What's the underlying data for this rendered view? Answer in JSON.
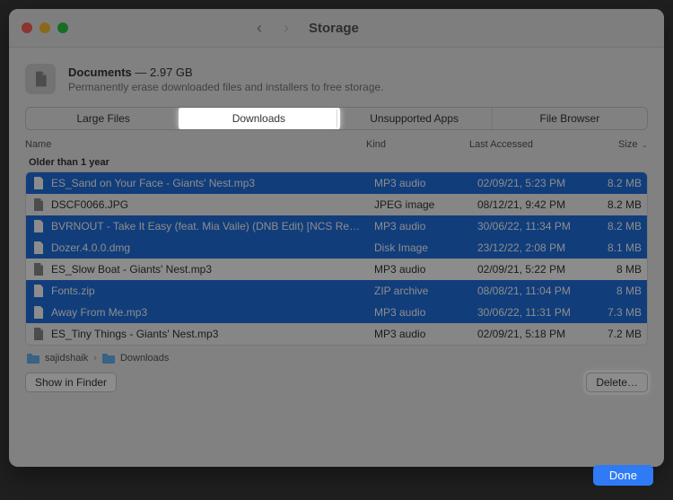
{
  "titlebar": {
    "title": "Storage",
    "traffic": {
      "close": "#ff5f57",
      "min": "#febc2e",
      "max": "#28c840"
    }
  },
  "header": {
    "title_strong": "Documents",
    "title_size": " — 2.97 GB",
    "subtitle": "Permanently erase downloaded files and installers to free storage."
  },
  "tabs": [
    {
      "label": "Large Files",
      "active": false
    },
    {
      "label": "Downloads",
      "active": true
    },
    {
      "label": "Unsupported Apps",
      "active": false
    },
    {
      "label": "File Browser",
      "active": false
    }
  ],
  "columns": {
    "name": "Name",
    "kind": "Kind",
    "last": "Last Accessed",
    "size": "Size"
  },
  "section": "Older than 1 year",
  "rows": [
    {
      "name": "ES_Sand on Your Face - Giants' Nest.mp3",
      "kind": "MP3 audio",
      "date": "02/09/21, 5:23 PM",
      "size": "8.2 MB",
      "sel": true,
      "icon": "audio"
    },
    {
      "name": "DSCF0066.JPG",
      "kind": "JPEG image",
      "date": "08/12/21, 9:42 PM",
      "size": "8.2 MB",
      "sel": false,
      "icon": "image"
    },
    {
      "name": "BVRNOUT - Take It Easy (feat. Mia Vaile) (DNB Edit) [NCS Re…",
      "kind": "MP3 audio",
      "date": "30/06/22, 11:34 PM",
      "size": "8.2 MB",
      "sel": true,
      "icon": "audio"
    },
    {
      "name": "Dozer.4.0.0.dmg",
      "kind": "Disk Image",
      "date": "23/12/22, 2:08 PM",
      "size": "8.1 MB",
      "sel": true,
      "icon": "dmg"
    },
    {
      "name": "ES_Slow Boat - Giants' Nest.mp3",
      "kind": "MP3 audio",
      "date": "02/09/21, 5:22 PM",
      "size": "8 MB",
      "sel": false,
      "icon": "audio"
    },
    {
      "name": "Fonts.zip",
      "kind": "ZIP archive",
      "date": "08/08/21, 11:04 PM",
      "size": "8 MB",
      "sel": true,
      "icon": "zip"
    },
    {
      "name": "Away From Me.mp3",
      "kind": "MP3 audio",
      "date": "30/06/22, 11:31 PM",
      "size": "7.3 MB",
      "sel": true,
      "icon": "audio"
    },
    {
      "name": "ES_Tiny Things - Giants' Nest.mp3",
      "kind": "MP3 audio",
      "date": "02/09/21, 5:18 PM",
      "size": "7.2 MB",
      "sel": false,
      "icon": "audio"
    }
  ],
  "breadcrumbs": {
    "a": "sajidshaik",
    "b": "Downloads"
  },
  "footer": {
    "show": "Show in Finder",
    "delete": "Delete…",
    "done": "Done"
  }
}
